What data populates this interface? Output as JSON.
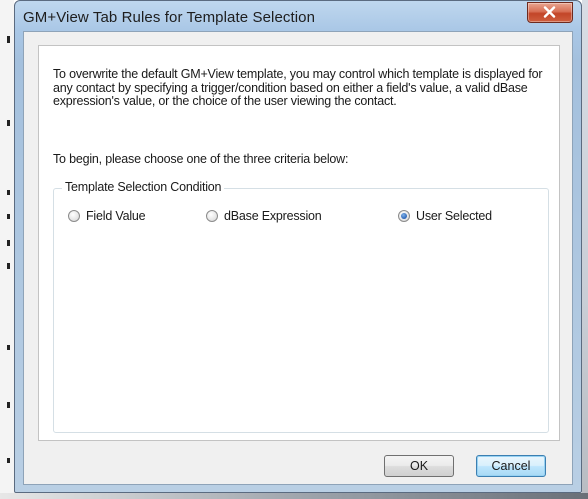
{
  "window": {
    "title": "GM+View Tab Rules for  Template Selection"
  },
  "description": "To overwrite the default GM+View template, you may control which template is displayed for any contact by specifying a trigger/condition based on either a field's value, a valid dBase expression's value, or the choice of the user viewing the contact.",
  "prompt": "To begin, please choose one of the three criteria below:",
  "group": {
    "legend": "Template Selection Condition",
    "options": [
      {
        "label": "Field Value",
        "selected": false
      },
      {
        "label": "dBase Expression",
        "selected": false
      },
      {
        "label": "User Selected",
        "selected": true
      }
    ]
  },
  "buttons": {
    "ok": "OK",
    "cancel": "Cancel"
  }
}
